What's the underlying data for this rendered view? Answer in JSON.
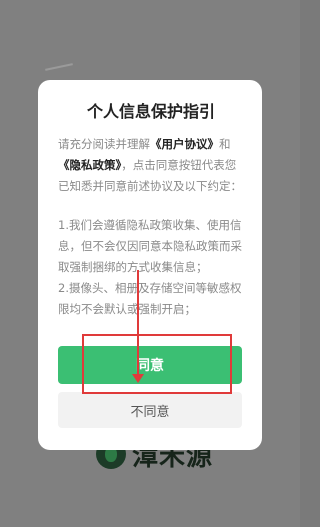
{
  "background": {
    "logo_text": "漳禾源"
  },
  "dialog": {
    "title": "个人信息保护指引",
    "intro_1": "请充分阅读并理解",
    "user_agreement": "《用户协议》",
    "intro_2": "和",
    "privacy_policy": "《隐私政策》",
    "intro_3": "，点击同意按钮代表您已知悉并同意前述协议及以下约定：",
    "term_1": "1.我们会遵循隐私政策收集、使用信息，但不会仅因同意本隐私政策而采取强制捆绑的方式收集信息；",
    "term_2": "2.摄像头、相册及存储空间等敏感权限均不会默认或强制开启；",
    "agree_label": "同意",
    "disagree_label": "不同意"
  },
  "colors": {
    "accent_green": "#3bbf73",
    "annotation_red": "#e03a3a",
    "overlay_gray": "#808080"
  }
}
